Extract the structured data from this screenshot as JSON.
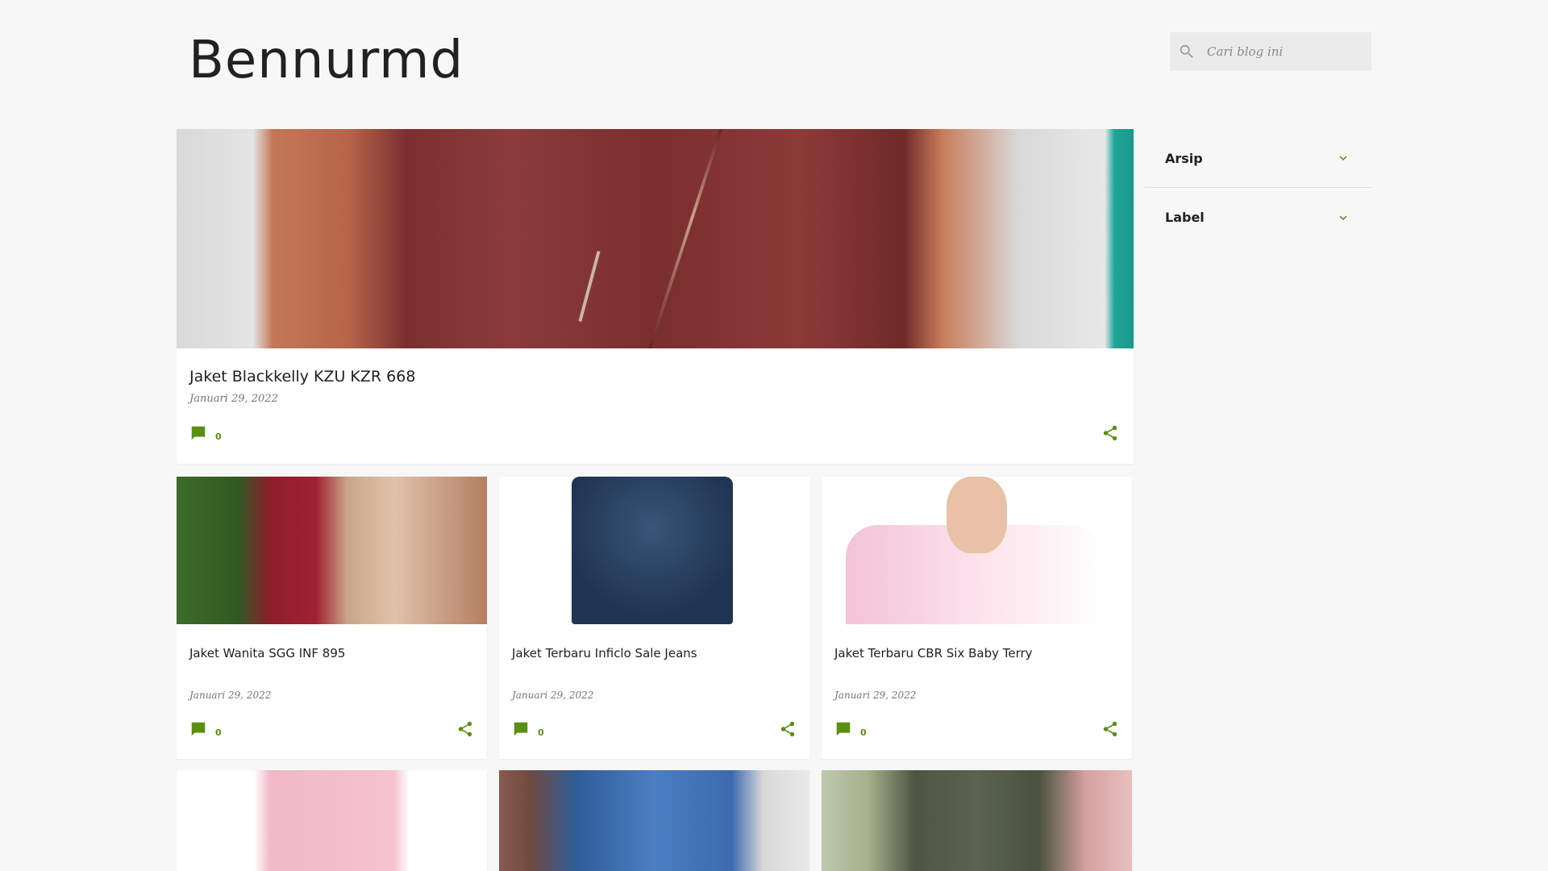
{
  "header": {
    "title": "Bennurmd"
  },
  "search": {
    "placeholder": "Cari blog ini"
  },
  "colors": {
    "accent": "#5a8f12",
    "background": "#f7f7f7",
    "card": "#ffffff"
  },
  "featured": {
    "title": "Jaket Blackkelly KZU KZR 668",
    "date": "Januari 29, 2022",
    "comments": "0"
  },
  "posts": [
    {
      "title": "Jaket Wanita SGG INF 895",
      "date": "Januari 29, 2022",
      "comments": "0"
    },
    {
      "title": "Jaket Terbaru Inficlo Sale Jeans",
      "date": "Januari 29, 2022",
      "comments": "0"
    },
    {
      "title": "Jaket Terbaru CBR Six Baby Terry",
      "date": "Januari 29, 2022",
      "comments": "0"
    }
  ],
  "sidebar": {
    "widgets": [
      {
        "label": "Arsip",
        "icon": "chevron-down-icon"
      },
      {
        "label": "Label",
        "icon": "chevron-down-icon"
      }
    ]
  }
}
